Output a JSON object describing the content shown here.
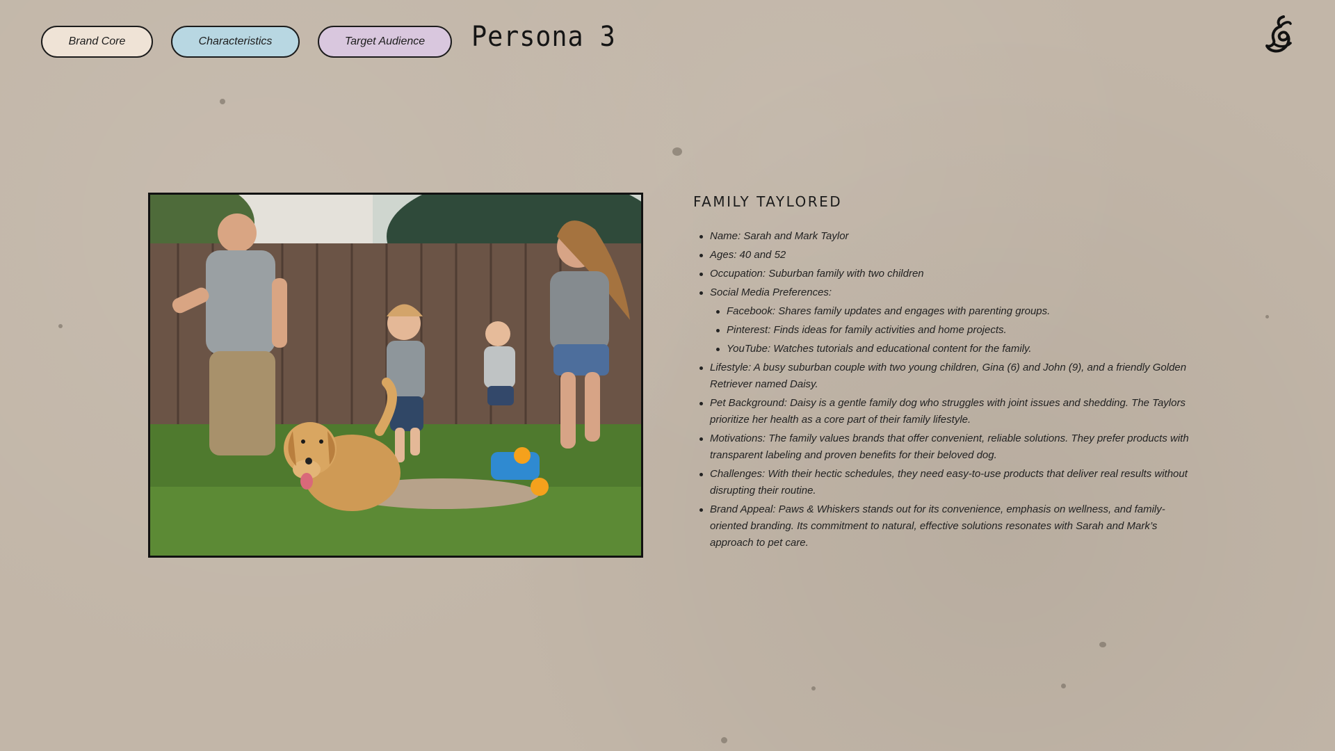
{
  "nav": {
    "brand_core": "Brand Core",
    "characteristics": "Characteristics",
    "target_audience": "Target Audience"
  },
  "page_title": "Persona 3",
  "logo_icon": "hand-drawn-swirl-logo-icon",
  "photo": {
    "description_icon": "family-with-dog-photo"
  },
  "persona": {
    "heading": "FAMILY TAYLORED",
    "items": [
      "Name: Sarah and Mark Taylor",
      "Ages: 40 and 52",
      "Occupation: Suburban family with two children",
      "Social Media Preferences:"
    ],
    "social": [
      "Facebook: Shares family updates and engages with parenting groups.",
      "Pinterest: Finds ideas for family activities and home projects.",
      "YouTube: Watches tutorials and educational content for the family."
    ],
    "details": [
      "Lifestyle: A busy suburban couple with two young children, Gina (6) and John (9), and a friendly Golden Retriever named Daisy.",
      "Pet Background: Daisy is a gentle family dog who struggles with joint issues and shedding. The Taylors prioritize her health as a core part of their family lifestyle.",
      "Motivations: The family values brands that offer convenient, reliable solutions. They prefer products with transparent labeling and proven benefits for their beloved dog.",
      "Challenges: With their hectic schedules, they need easy-to-use products that deliver real results without disrupting their routine.",
      "Brand Appeal: Paws & Whiskers stands out for its convenience, emphasis on wellness, and family-oriented branding. Its commitment to natural, effective solutions resonates with Sarah and Mark’s approach to pet care."
    ]
  },
  "colors": {
    "background": "#c2b6a8",
    "brand_core_pill": "#efe3d6",
    "characteristics_pill": "#b8d7e2",
    "target_audience_pill": "#d9c7de"
  }
}
